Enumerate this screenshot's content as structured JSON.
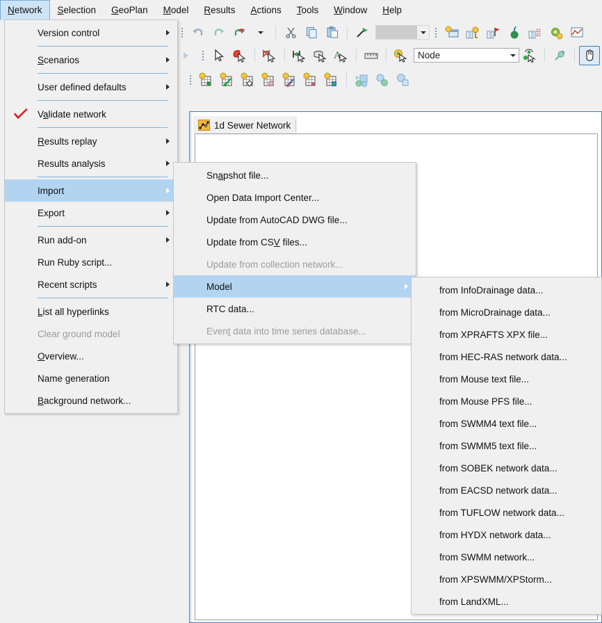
{
  "app": {
    "menubar": [
      {
        "label": "Network",
        "accel": "N",
        "active": true
      },
      {
        "label": "Selection",
        "accel": "S",
        "active": false
      },
      {
        "label": "GeoPlan",
        "accel": "G",
        "active": false
      },
      {
        "label": "Model",
        "accel": "M",
        "active": false
      },
      {
        "label": "Results",
        "accel": "R",
        "active": false
      },
      {
        "label": "Actions",
        "accel": "A",
        "active": false
      },
      {
        "label": "Tools",
        "accel": "T",
        "active": false
      },
      {
        "label": "Window",
        "accel": "W",
        "active": false
      },
      {
        "label": "Help",
        "accel": "H",
        "active": false
      }
    ]
  },
  "toolbar": {
    "row1_icons": [
      "undo-icon",
      "redo-icon",
      "redo-all-icon",
      "undo-dropdown-icon",
      "cut-icon",
      "copy-icon",
      "paste-icon",
      "flag-icon"
    ],
    "row2_icons": [
      "pan-left-icon",
      "select-pointer-icon",
      "select-polygon-icon",
      "deselect-icon",
      "select-link-icon",
      "select-manhole-icon",
      "select-text-icon",
      "measure-icon",
      "select-symbol-icon",
      "trace-node-icon",
      "probe-icon",
      "hand-tool-icon"
    ],
    "row3_icons": [
      "grid-node-icon",
      "grid-link-icon",
      "grid-polygon-icon",
      "grid-subcatchment-icon",
      "grid-pipe-icon",
      "grid-point-icon",
      "grid-green-icon",
      "theme-1-icon",
      "theme-2-icon",
      "theme-3-icon"
    ],
    "row1_right_icons": [
      "scenario-icon",
      "key-icon",
      "flag-tag-icon",
      "spray-icon",
      "numbering-icon",
      "settings-icon",
      "graph-icon"
    ],
    "style_combo": {
      "value": "",
      "placeholder": "",
      "disabled": true
    },
    "layer_combo": {
      "value": "Node",
      "placeholder": "Node"
    }
  },
  "document": {
    "tab_label": "1d Sewer Network",
    "tab_icon": "network-document-icon"
  },
  "colors": {
    "menu_highlight": "#b3d4f0",
    "menubar_active": "#cde4f7",
    "separator": "#5c9ccc",
    "disabled_text": "#9b9b9b",
    "check_mark": "#e01b24",
    "doc_border": "#4a7ba7"
  },
  "menus": {
    "network": {
      "title": "Network",
      "items": [
        {
          "label": "Version control",
          "accel": "",
          "submenu": true,
          "disabled": false,
          "checked": false,
          "sep_after": true
        },
        {
          "label": "Scenarios",
          "accel": "S",
          "submenu": true,
          "disabled": false,
          "checked": false,
          "sep_after": true
        },
        {
          "label": "User defined defaults",
          "accel": "",
          "submenu": true,
          "disabled": false,
          "checked": false,
          "sep_after": true
        },
        {
          "label": "Validate network",
          "accel": "a",
          "submenu": false,
          "disabled": false,
          "checked": true,
          "sep_after": true
        },
        {
          "label": "Results replay",
          "accel": "R",
          "submenu": true,
          "disabled": false,
          "checked": false,
          "sep_after": false
        },
        {
          "label": "Results analysis",
          "accel": "",
          "submenu": true,
          "disabled": false,
          "checked": false,
          "sep_after": true
        },
        {
          "label": "Import",
          "accel": "",
          "submenu": true,
          "disabled": false,
          "checked": false,
          "sep_after": false,
          "highlighted": true
        },
        {
          "label": "Export",
          "accel": "",
          "submenu": true,
          "disabled": false,
          "checked": false,
          "sep_after": true
        },
        {
          "label": "Run add-on",
          "accel": "",
          "submenu": true,
          "disabled": false,
          "checked": false,
          "sep_after": false
        },
        {
          "label": "Run Ruby script...",
          "accel": "",
          "submenu": false,
          "disabled": false,
          "checked": false,
          "sep_after": false
        },
        {
          "label": "Recent scripts",
          "accel": "",
          "submenu": true,
          "disabled": false,
          "checked": false,
          "sep_after": true
        },
        {
          "label": "List all hyperlinks",
          "accel": "L",
          "submenu": false,
          "disabled": false,
          "checked": false,
          "sep_after": false
        },
        {
          "label": "Clear ground model",
          "accel": "",
          "submenu": false,
          "disabled": true,
          "checked": false,
          "sep_after": false
        },
        {
          "label": "Overview...",
          "accel": "O",
          "submenu": false,
          "disabled": false,
          "checked": false,
          "sep_after": false
        },
        {
          "label": "Name generation",
          "accel": "",
          "submenu": false,
          "disabled": false,
          "checked": false,
          "sep_after": false
        },
        {
          "label": "Background network...",
          "accel": "B",
          "submenu": false,
          "disabled": false,
          "checked": false,
          "sep_after": false
        }
      ]
    },
    "import": {
      "title": "Import",
      "items": [
        {
          "label": "Snapshot file...",
          "accel": "a",
          "submenu": false,
          "disabled": false,
          "highlighted": false
        },
        {
          "label": "Open Data Import Center...",
          "accel": "",
          "submenu": false,
          "disabled": false,
          "highlighted": false
        },
        {
          "label": "Update from AutoCAD DWG file...",
          "accel": "",
          "submenu": false,
          "disabled": false,
          "highlighted": false
        },
        {
          "label": "Update from CSV files...",
          "accel": "V",
          "submenu": false,
          "disabled": false,
          "highlighted": false
        },
        {
          "label": "Update from collection network...",
          "accel": "",
          "submenu": false,
          "disabled": true,
          "highlighted": false
        },
        {
          "label": "Model",
          "accel": "",
          "submenu": true,
          "disabled": false,
          "highlighted": true
        },
        {
          "label": "RTC data...",
          "accel": "",
          "submenu": false,
          "disabled": false,
          "highlighted": false
        },
        {
          "label": "Event data into time series database...",
          "accel": "t",
          "submenu": false,
          "disabled": true,
          "highlighted": false
        }
      ]
    },
    "model": {
      "title": "Model",
      "items": [
        {
          "label": "from InfoDrainage data..."
        },
        {
          "label": "from MicroDrainage data..."
        },
        {
          "label": "from XPRAFTS XPX file..."
        },
        {
          "label": "from HEC-RAS network data..."
        },
        {
          "label": "from Mouse text file..."
        },
        {
          "label": "from Mouse PFS file..."
        },
        {
          "label": "from SWMM4 text file..."
        },
        {
          "label": "from SWMM5 text file..."
        },
        {
          "label": "from SOBEK network data..."
        },
        {
          "label": "from EACSD network data..."
        },
        {
          "label": "from TUFLOW network data..."
        },
        {
          "label": "from HYDX network data..."
        },
        {
          "label": "from SWMM network..."
        },
        {
          "label": "from XPSWMM/XPStorm..."
        },
        {
          "label": "from LandXML..."
        }
      ]
    }
  }
}
